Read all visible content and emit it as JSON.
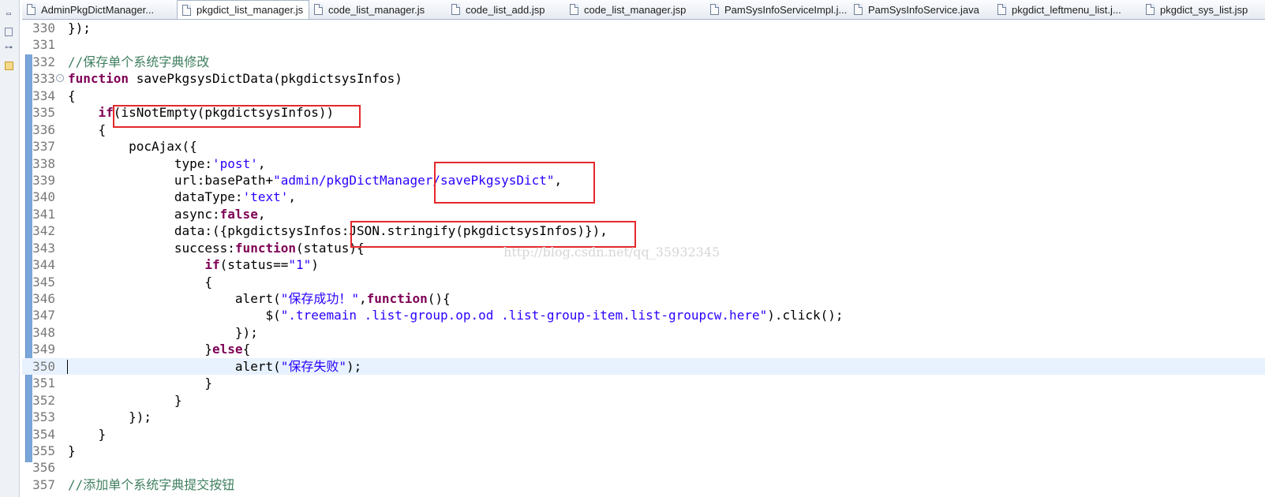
{
  "tabs": [
    {
      "label": "AdminPkgDictManager...",
      "active": false
    },
    {
      "label": "pkgdict_list_manager.js",
      "active": true,
      "close": "✕"
    },
    {
      "label": "code_list_manager.js",
      "active": false
    },
    {
      "label": "code_list_add.jsp",
      "active": false
    },
    {
      "label": "code_list_manager.jsp",
      "active": false
    },
    {
      "label": "PamSysInfoServiceImpl.j...",
      "active": false
    },
    {
      "label": "PamSysInfoService.java",
      "active": false
    },
    {
      "label": "pkgdict_leftmenu_list.j...",
      "active": false
    },
    {
      "label": "pkgdict_sys_list.jsp",
      "active": false
    }
  ],
  "trim_icons": [
    "restore-icon",
    "outline-icon",
    "hierarchy-icon",
    "package-icon"
  ],
  "lines": [
    {
      "n": "330",
      "tokens": [
        [
          "p",
          "});"
        ]
      ]
    },
    {
      "n": "331",
      "tokens": []
    },
    {
      "n": "332",
      "tokens": [
        [
          "c",
          "//保存单个系统字典修改"
        ]
      ]
    },
    {
      "n": "333",
      "fold": "⊖",
      "tokens": [
        [
          "k",
          "function"
        ],
        [
          "p",
          " savePkgsysDictData(pkgdictsysInfos)"
        ]
      ]
    },
    {
      "n": "334",
      "tokens": [
        [
          "p",
          "{"
        ]
      ]
    },
    {
      "n": "335",
      "tokens": [
        [
          "p",
          "    "
        ],
        [
          "k",
          "if"
        ],
        [
          "p",
          "(isNotEmpty(pkgdictsysInfos))"
        ]
      ]
    },
    {
      "n": "336",
      "tokens": [
        [
          "p",
          "    {"
        ]
      ]
    },
    {
      "n": "337",
      "tokens": [
        [
          "p",
          "        pocAjax({"
        ]
      ]
    },
    {
      "n": "338",
      "tokens": [
        [
          "p",
          "              type:"
        ],
        [
          "s",
          "'post'"
        ],
        [
          "p",
          ","
        ]
      ]
    },
    {
      "n": "339",
      "tokens": [
        [
          "p",
          "              url:basePath+"
        ],
        [
          "s",
          "\"admin/pkgDictManager/savePkgsysDict\""
        ],
        [
          "p",
          ","
        ]
      ]
    },
    {
      "n": "340",
      "tokens": [
        [
          "p",
          "              dataType:"
        ],
        [
          "s",
          "'text'"
        ],
        [
          "p",
          ","
        ]
      ]
    },
    {
      "n": "341",
      "tokens": [
        [
          "p",
          "              async:"
        ],
        [
          "k",
          "false"
        ],
        [
          "p",
          ","
        ]
      ]
    },
    {
      "n": "342",
      "tokens": [
        [
          "p",
          "              data:({pkgdictsysInfos:JSON.stringify(pkgdictsysInfos)}),"
        ]
      ]
    },
    {
      "n": "343",
      "tokens": [
        [
          "p",
          "              success:"
        ],
        [
          "k",
          "function"
        ],
        [
          "p",
          "(status){"
        ]
      ]
    },
    {
      "n": "344",
      "tokens": [
        [
          "p",
          "                  "
        ],
        [
          "k",
          "if"
        ],
        [
          "p",
          "(status=="
        ],
        [
          "s",
          "\"1\""
        ],
        [
          "p",
          ")"
        ]
      ]
    },
    {
      "n": "345",
      "tokens": [
        [
          "p",
          "                  {"
        ]
      ]
    },
    {
      "n": "346",
      "tokens": [
        [
          "p",
          "                      alert("
        ],
        [
          "s",
          "\"保存成功！\""
        ],
        [
          "p",
          ","
        ],
        [
          "k",
          "function"
        ],
        [
          "p",
          "(){"
        ]
      ]
    },
    {
      "n": "347",
      "tokens": [
        [
          "p",
          "                          $("
        ],
        [
          "s",
          "\".treemain .list-group.op.od .list-group-item.list-groupcw.here\""
        ],
        [
          "p",
          ").click();"
        ]
      ]
    },
    {
      "n": "348",
      "tokens": [
        [
          "p",
          "                      });"
        ]
      ]
    },
    {
      "n": "349",
      "tokens": [
        [
          "p",
          "                  }"
        ],
        [
          "k",
          "else"
        ],
        [
          "p",
          "{"
        ]
      ]
    },
    {
      "n": "350",
      "current": true,
      "tokens": [
        [
          "p",
          "                      alert("
        ],
        [
          "s",
          "\"保存失败\""
        ],
        [
          "p",
          ");"
        ]
      ]
    },
    {
      "n": "351",
      "tokens": [
        [
          "p",
          "                  }"
        ]
      ]
    },
    {
      "n": "352",
      "tokens": [
        [
          "p",
          "              }"
        ]
      ]
    },
    {
      "n": "353",
      "tokens": [
        [
          "p",
          "        });"
        ]
      ]
    },
    {
      "n": "354",
      "tokens": [
        [
          "p",
          "    }"
        ]
      ]
    },
    {
      "n": "355",
      "tokens": [
        [
          "p",
          "}"
        ]
      ]
    },
    {
      "n": "356",
      "tokens": []
    },
    {
      "n": "357",
      "tokens": [
        [
          "c",
          "//添加单个系统字典提交按钮"
        ]
      ]
    }
  ],
  "watermark": "http://blog.csdn.net/qq_35932345",
  "colors": {
    "keyword": "#7f0055",
    "string": "#2a00ff",
    "comment": "#3f7f5f",
    "annotation_box": "#e4282b"
  }
}
